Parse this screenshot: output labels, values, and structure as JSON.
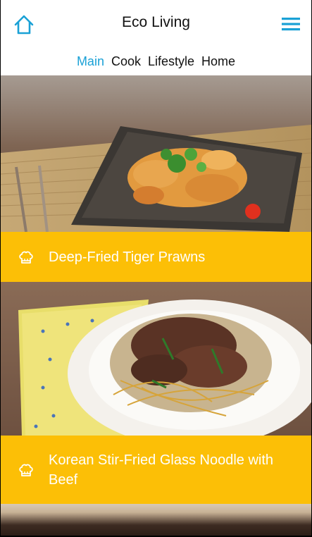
{
  "header": {
    "title": "Eco Living",
    "home_icon": "home-icon",
    "menu_icon": "hamburger-menu-icon"
  },
  "tabs": [
    {
      "label": "Main",
      "active": true
    },
    {
      "label": "Cook",
      "active": false
    },
    {
      "label": "Lifestyle",
      "active": false
    },
    {
      "label": "Home",
      "active": false
    }
  ],
  "recipes": [
    {
      "title": "Deep-Fried Tiger Prawns",
      "icon": "chef-hat-icon"
    },
    {
      "title": "Korean Stir-Fried Glass Noodle with Beef",
      "icon": "chef-hat-icon"
    }
  ],
  "colors": {
    "accent": "#1aa1d6",
    "caption_background": "#fcbf06",
    "caption_text": "#ffffff"
  }
}
